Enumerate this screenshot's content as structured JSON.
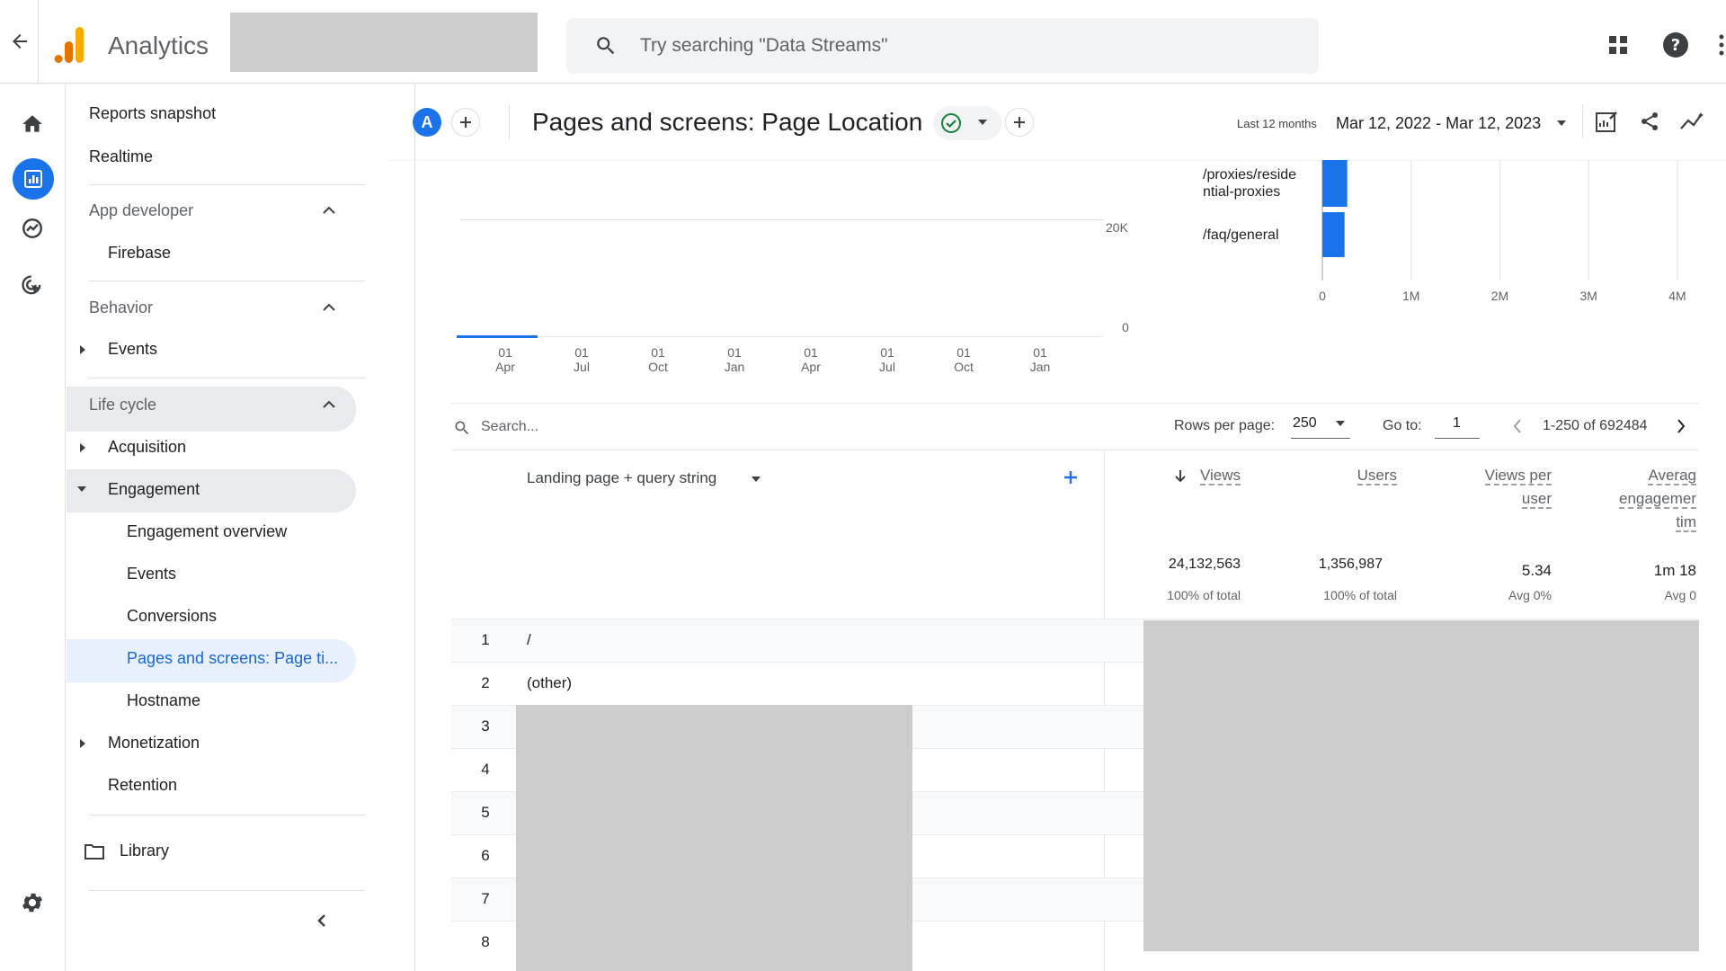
{
  "header": {
    "app_name": "Analytics",
    "search_placeholder": "Try searching \"Data Streams\""
  },
  "sidebar": {
    "reports_snapshot": "Reports snapshot",
    "realtime": "Realtime",
    "app_developer": "App developer",
    "firebase": "Firebase",
    "behavior": "Behavior",
    "behavior_events": "Events",
    "life_cycle": "Life cycle",
    "acquisition": "Acquisition",
    "engagement": "Engagement",
    "engagement_overview": "Engagement overview",
    "engagement_events": "Events",
    "conversions": "Conversions",
    "pages_and_screens": "Pages and screens: Page ti...",
    "hostname": "Hostname",
    "monetization": "Monetization",
    "retention": "Retention",
    "library": "Library"
  },
  "toolbar": {
    "avatar_letter": "A",
    "report_title": "Pages and screens: Page Location",
    "date_range_label": "Last 12 months",
    "date_range": "Mar 12, 2022 - Mar 12, 2023"
  },
  "line_chart": {
    "y_ticks": [
      "20K",
      "0"
    ],
    "x_ticks": [
      [
        "01",
        "Apr"
      ],
      [
        "01",
        "Jul"
      ],
      [
        "01",
        "Oct"
      ],
      [
        "01",
        "Jan"
      ],
      [
        "01",
        "Apr"
      ],
      [
        "01",
        "Jul"
      ],
      [
        "01",
        "Oct"
      ],
      [
        "01",
        "Jan"
      ]
    ]
  },
  "chart_data": {
    "type": "bar",
    "orientation": "horizontal",
    "categories": [
      "/proxies/residential-proxies",
      "/faq/general"
    ],
    "category_labels": [
      [
        "/proxies/reside",
        "ntial-proxies"
      ],
      [
        "/faq/general"
      ]
    ],
    "values": [
      280000,
      250000
    ],
    "x_ticks": [
      "0",
      "1M",
      "2M",
      "3M",
      "4M"
    ],
    "xlim": [
      0,
      4000000
    ],
    "color": "#1a73e8"
  },
  "table": {
    "search_placeholder": "Search...",
    "rows_per_page_label": "Rows per page:",
    "rows_per_page_value": "250",
    "goto_label": "Go to:",
    "goto_value": "1",
    "pagination": "1-250 of 692484",
    "dimension_header": "Landing page + query string",
    "col_views": "Views",
    "col_users": "Users",
    "col_views_per_user": [
      "Views per",
      "user"
    ],
    "col_avg_engagement": [
      "Averag",
      "engagemer",
      "tim"
    ],
    "totals": {
      "views": "24,132,563",
      "views_sub": "100% of total",
      "users": "1,356,987",
      "users_sub": "100% of total",
      "vpu": "5.34",
      "vpu_sub": "Avg 0%",
      "aet": "1m 18",
      "aet_sub": "Avg 0"
    },
    "rows": [
      {
        "n": "1",
        "page": "/"
      },
      {
        "n": "2",
        "page": "(other)"
      },
      {
        "n": "3",
        "page": ""
      },
      {
        "n": "4",
        "page": ""
      },
      {
        "n": "5",
        "page": ""
      },
      {
        "n": "6",
        "page": ""
      },
      {
        "n": "7",
        "page": ""
      },
      {
        "n": "8",
        "page": ""
      }
    ]
  },
  "colors": {
    "accent": "#1a73e8",
    "logo_orange": "#f9ab00",
    "logo_dark_orange": "#e37400",
    "success": "#188038"
  }
}
